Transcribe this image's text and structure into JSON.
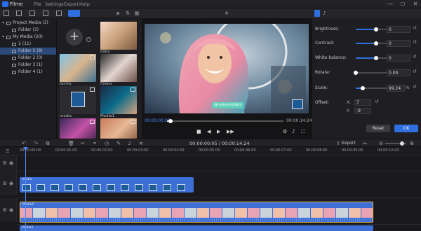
{
  "app": {
    "name": "Filme"
  },
  "menu": [
    "File",
    "Settings",
    "Export",
    "Help"
  ],
  "window_controls": {
    "minimize": "—",
    "maximize": "☐",
    "close": "✕"
  },
  "tree": [
    {
      "label": "Project Media (3)",
      "indent": 0,
      "selected": false
    },
    {
      "label": "Folder (3)",
      "indent": 1,
      "selected": false
    },
    {
      "label": "My Media (20)",
      "indent": 0,
      "selected": false
    },
    {
      "label": "1 (11)",
      "indent": 1,
      "selected": false
    },
    {
      "label": "Folder 5 (8)",
      "indent": 1,
      "selected": true
    },
    {
      "label": "Folder 2 (0)",
      "indent": 1,
      "selected": false
    },
    {
      "label": "Folder 3 (1)",
      "indent": 1,
      "selected": false
    },
    {
      "label": "Folder 4 (1)",
      "indent": 1,
      "selected": false
    }
  ],
  "tree_toggles": [
    "▾",
    "",
    "▾",
    "",
    "",
    "",
    "",
    ""
  ],
  "thumbnails": [
    {
      "label": "",
      "colors": [
        "#f4d8c8",
        "#c9a07a",
        "#7a5840"
      ]
    },
    {
      "label": "baby",
      "colors": [
        "#e8ddd4",
        "#9a8b80",
        "#4e4540"
      ]
    },
    {
      "label": "family",
      "colors": [
        "#7fc4ea",
        "#d9b48e",
        "#3f6f8f"
      ]
    },
    {
      "label": "flower",
      "colors": [
        "#2b2b2b",
        "#e3d6cf",
        "#6b4f4a"
      ]
    },
    {
      "label": "media",
      "colors": [
        "#2c2c30",
        "#2c2c30",
        "#2c2c30"
      ]
    },
    {
      "label": "Media1",
      "colors": [
        "#1a2a46",
        "#0d6b8a",
        "#d7a37d"
      ]
    },
    {
      "label": "",
      "colors": [
        "#3a2858",
        "#c452a8",
        "#2a1a3a"
      ]
    },
    {
      "label": "",
      "colors": [
        "#c87a58",
        "#e8b896",
        "#7a4a38"
      ]
    }
  ],
  "preview": {
    "number": "4",
    "current_time": "00:00:00:05",
    "duration": "00:00:14:24",
    "progress": 0.03,
    "caption": "@mylovelyGirls"
  },
  "preview_controls": [
    "■",
    "◀",
    "▶",
    "▶▶"
  ],
  "properties": {
    "brightness": {
      "label": "Brightness:",
      "value": "0",
      "level": 0.5
    },
    "contrast": {
      "label": "Contrast:",
      "value": "0",
      "level": 0.5
    },
    "white_balance": {
      "label": "White balance:",
      "value": "0",
      "level": 0.5
    },
    "rotate": {
      "label": "Rotate:",
      "value": "0.00",
      "level": 0.0
    },
    "scale": {
      "label": "Scale:",
      "value": "99.24",
      "level": 0.17,
      "unit": "%"
    },
    "offset": {
      "label": "Offset:",
      "x_label": "X:",
      "x": "7",
      "y_label": "Y:",
      "y": "-9"
    },
    "reset_label": "Reset",
    "ok_label": "OK",
    "preset_glyph": "↺"
  },
  "edit_toolbar": {
    "timecode": "00:00:00:05 / 00:00:14:24",
    "export_label": "Export",
    "zoom_level": 0.8
  },
  "ruler_labels": [
    "00:00:00:00",
    "00:00:01:00",
    "00:00:02:00",
    "00:00:03:00",
    "00:00:04:00",
    "00:00:05:00",
    "00:00:06:00",
    "00:00:07:00",
    "00:00:08:00",
    "00:00:09:00",
    "00:00:10:00"
  ],
  "clips": {
    "track1": "media",
    "track2": "Media1",
    "track3": "Media2"
  },
  "colors": {
    "accent": "#2f6fe0",
    "clip_blue": "#3d6fd6",
    "selected_folder": "#2c4a78"
  }
}
